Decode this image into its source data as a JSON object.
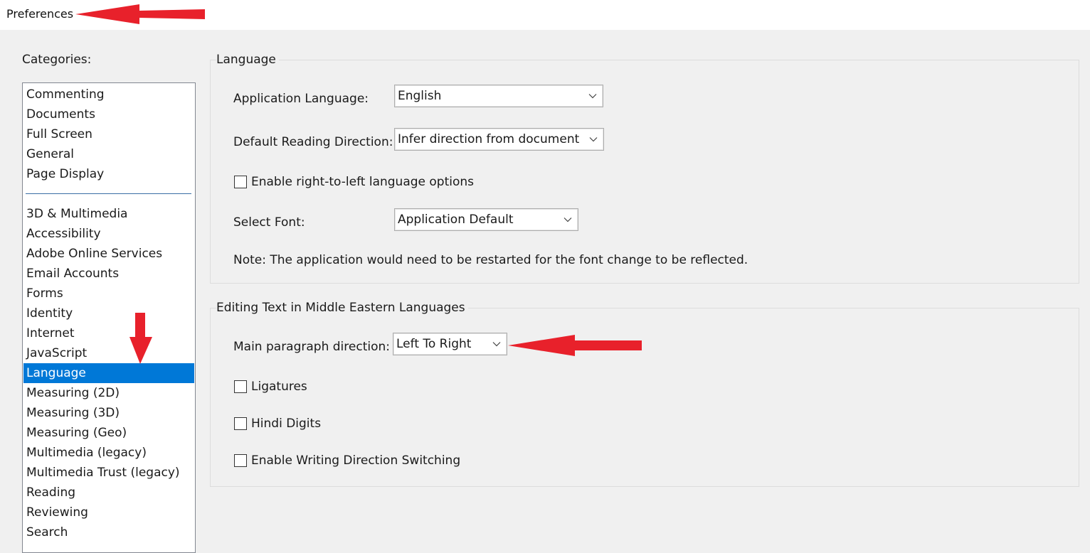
{
  "window": {
    "title": "Preferences"
  },
  "categories": {
    "label": "Categories:",
    "top_items": [
      "Commenting",
      "Documents",
      "Full Screen",
      "General",
      "Page Display"
    ],
    "items": [
      "3D & Multimedia",
      "Accessibility",
      "Adobe Online Services",
      "Email Accounts",
      "Forms",
      "Identity",
      "Internet",
      "JavaScript",
      "Language",
      "Measuring (2D)",
      "Measuring (3D)",
      "Measuring (Geo)",
      "Multimedia (legacy)",
      "Multimedia Trust (legacy)",
      "Reading",
      "Reviewing",
      "Search"
    ],
    "selected": "Language",
    "selected_color": "#0078d7"
  },
  "language_group": {
    "title": "Language",
    "app_language_label": "Application Language:",
    "app_language_value": "English",
    "reading_direction_label": "Default Reading Direction:",
    "reading_direction_value": "Infer direction from document",
    "rtl_checkbox_label": "Enable right-to-left language options",
    "rtl_checked": false,
    "font_label": "Select Font:",
    "font_value": "Application Default",
    "note": "Note: The application would need to be restarted for the font change to be reflected."
  },
  "middle_eastern_group": {
    "title": "Editing Text in Middle Eastern Languages",
    "paragraph_direction_label": "Main paragraph direction:",
    "paragraph_direction_value": "Left To Right",
    "ligatures_label": "Ligatures",
    "ligatures_checked": false,
    "hindi_digits_label": "Hindi Digits",
    "hindi_digits_checked": false,
    "writing_direction_label": "Enable Writing Direction Switching",
    "writing_direction_checked": false
  },
  "annotations": {
    "arrow_color": "#e8212b",
    "icon": "red-arrow-icon"
  }
}
